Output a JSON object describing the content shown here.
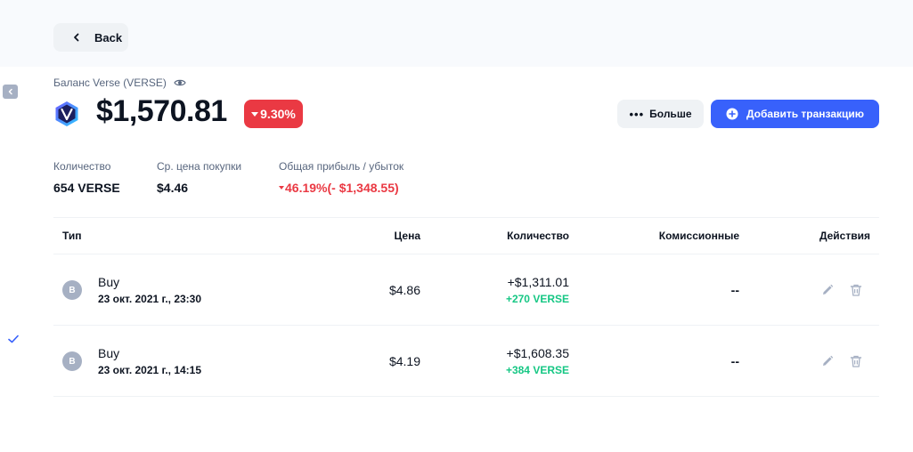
{
  "nav": {
    "back_label": "Back"
  },
  "header": {
    "balance_label": "Баланс Verse (VERSE)",
    "balance_value": "$1,570.81",
    "change_percent": "9.30%",
    "more_label": "Больше",
    "add_transaction_label": "Добавить транзакцию"
  },
  "stats": {
    "quantity": {
      "label": "Количество",
      "value": "654 VERSE"
    },
    "avg_price": {
      "label": "Ср. цена покупки",
      "value": "$4.46"
    },
    "pnl": {
      "label": "Общая прибыль / убыток",
      "value": "46.19%(- $1,348.55)"
    }
  },
  "table": {
    "columns": [
      "Тип",
      "Цена",
      "Количество",
      "Комиссионные",
      "Действия"
    ],
    "rows": [
      {
        "avatar": "B",
        "type": "Buy",
        "date": "23 окт. 2021 г., 23:30",
        "price": "$4.86",
        "amount": "+$1,311.01",
        "quantity": "+270 VERSE",
        "fee": "--"
      },
      {
        "avatar": "B",
        "type": "Buy",
        "date": "23 окт. 2021 г., 14:15",
        "price": "$4.19",
        "amount": "+$1,608.35",
        "quantity": "+384 VERSE",
        "fee": "--"
      }
    ]
  },
  "icons": {
    "back": "chevron-left-icon",
    "eye": "eye-icon",
    "coin": "verse-logo-icon",
    "more": "ellipsis-icon",
    "add": "plus-circle-icon",
    "edit": "pencil-icon",
    "delete": "trash-icon",
    "collapse": "chevron-left-icon",
    "check": "check-icon"
  },
  "colors": {
    "accent": "#3861fb",
    "negative": "#ea3943",
    "positive": "#16c784",
    "muted": "#58667e",
    "avatar": "#a6b0c3"
  }
}
